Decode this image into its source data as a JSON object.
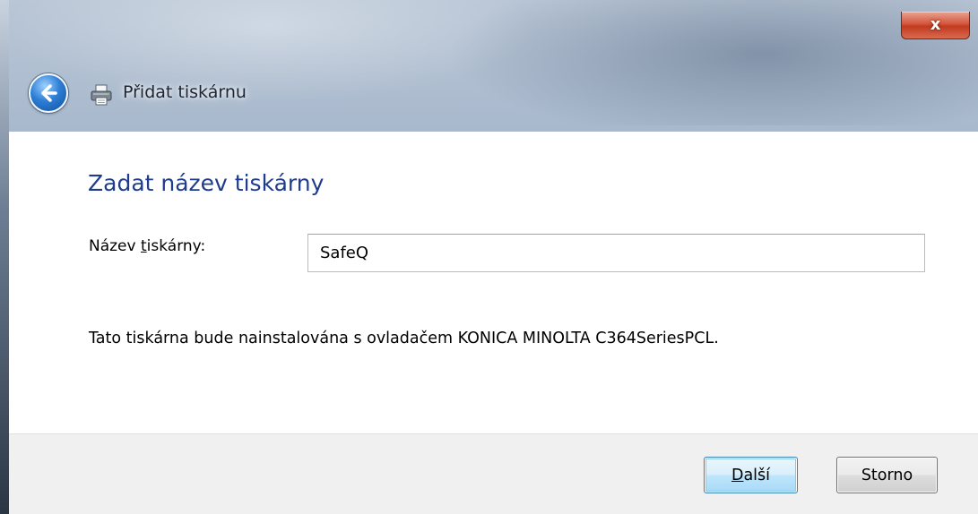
{
  "window": {
    "title": "Přidat tiskárnu",
    "close_glyph": "x"
  },
  "icons": {
    "back": "back-arrow-icon",
    "printer": "printer-icon",
    "close": "close-icon"
  },
  "main": {
    "heading": "Zadat název tiskárny",
    "name_label_prefix": "Název ",
    "name_label_accesskey": "t",
    "name_label_suffix": "iskárny:",
    "name_value": "SafeQ",
    "info": "Tato tiskárna bude nainstalována s ovladačem KONICA MINOLTA C364SeriesPCL."
  },
  "buttons": {
    "next_accesskey": "D",
    "next_rest": "alší",
    "cancel": "Storno"
  },
  "colors": {
    "heading": "#1e3c8c",
    "footer_bg": "#f0f0f0",
    "close_red": "#c23b20",
    "accent_blue": "#2d7fd6"
  }
}
